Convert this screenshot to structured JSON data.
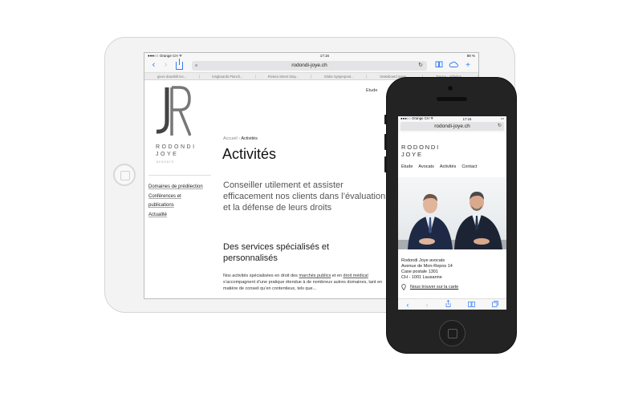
{
  "tablet": {
    "status": {
      "carrier": "●●●○○ Orange CH  ᯤ",
      "time": "17:16",
      "battery": "88 %"
    },
    "toolbar": {
      "back": "‹",
      "forward": "›",
      "reader": "≡",
      "url": "rodondi-joye.ch",
      "reload": "↻",
      "bookmarks_icon": "book-icon",
      "cloud_icon": "cloud-icon",
      "add": "+"
    },
    "bookmarks": [
      "givve downhill tec...",
      "longboards Planch...",
      "Riviera Street Stay...",
      "Globe Sysperpont...",
      "brakeboard inges...",
      "Trevna · Arbeiten..."
    ],
    "logo": {
      "line1": "RODONDI",
      "line2": "JOYE",
      "sub": "AVOCATS"
    },
    "sidebar": [
      "Domaines de prédilection",
      "Conférences et",
      "publications",
      "Actualité"
    ],
    "menu": "Etude",
    "breadcrumb": {
      "home": "Accueil",
      "sep": "›",
      "current": "Activités"
    },
    "title": "Activités",
    "lead": "Conseiller utilement et assister efficacement nos clients dans l’évaluation et la défense de leurs droits",
    "h2": "Des services spécialisés et personnalisés",
    "body": {
      "p1": "Nos activités spécialisées en droit des ",
      "link1": "marchés publics",
      "p2": " et en ",
      "link2": "droit médical",
      "p3": " s’accompagnent d’une pratique étendue à de nombreux autres domaines, tant en matière de conseil qu’en contentieux, tels que..."
    }
  },
  "phone": {
    "status": {
      "carrier": "●●●○○ Orange CH  ᯤ",
      "time": "17:16",
      "battery": "▭"
    },
    "url": "rodondi-joye.ch",
    "reload": "↻",
    "logo": {
      "line1": "RODONDI",
      "line2": "JOYE"
    },
    "menu": [
      "Etude",
      "Avocats",
      "Activités",
      "Contact"
    ],
    "address": [
      "Rodondi Joye avocats",
      "Avenue de Mon-Repos 14",
      "Case postale 1301",
      "CH - 1001 Lausanne"
    ],
    "map_link": "Nous trouver sur la carte",
    "bottom": {
      "back": "‹",
      "forward": "›",
      "share_icon": "share-icon",
      "bookmarks_icon": "book-icon",
      "tabs_icon": "tabs-icon"
    }
  },
  "colors": {
    "ios_blue": "#2f7cf6",
    "phone_body": "#232323",
    "tablet_body": "#f3f3f3"
  }
}
